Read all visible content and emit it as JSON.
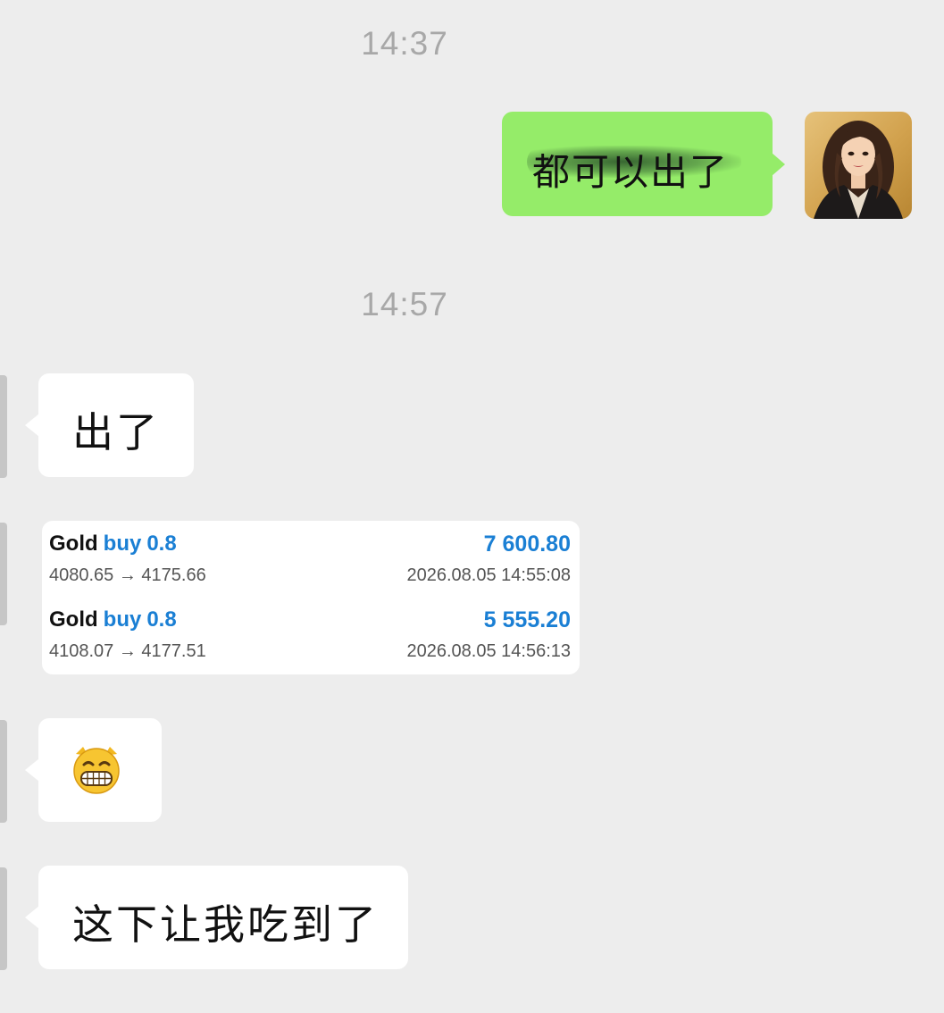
{
  "timestamps": [
    "14:37",
    "14:57"
  ],
  "sent_message": {
    "text": "都可以出了",
    "note": ""
  },
  "received_messages": [
    {
      "text": "出了"
    },
    {
      "text": "😁"
    },
    {
      "text": "这下让我吃到了"
    }
  ],
  "trades": [
    {
      "symbol": "Gold",
      "side": "buy",
      "lots": "0.8",
      "profit": "7 600.80",
      "prices": "4080.65 → 4175.66",
      "time": "2026.08.05 14:55:08"
    },
    {
      "symbol": "Gold",
      "side": "buy",
      "lots": "0.8",
      "profit": "5 555.20",
      "prices": "4108.07 → 4177.51",
      "time": "2026.08.05 14:56:13"
    }
  ],
  "colors": {
    "background": "#ededed",
    "sent_bubble": "#95ec69",
    "received_bubble": "#ffffff",
    "timestamp": "#a8a8a8",
    "accent_blue": "#1a7fd4"
  }
}
